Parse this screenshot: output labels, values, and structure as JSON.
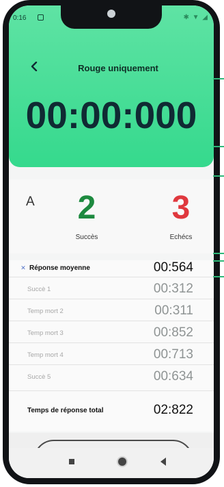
{
  "status_bar": {
    "time": "0:16"
  },
  "header": {
    "title": "Rouge uniquement",
    "timer": "00:00:000"
  },
  "stats": {
    "label": "A",
    "success_count": "2",
    "success_label": "Succès",
    "fail_count": "3",
    "fail_label": "Echécs"
  },
  "list": {
    "average": {
      "label": "Réponse moyenne",
      "value": "00:564",
      "icon": "x-icon"
    },
    "rows": [
      {
        "label": "Succè 1",
        "value": "00:312"
      },
      {
        "label": "Temp mort 2",
        "value": "00:311"
      },
      {
        "label": "Temp mort 3",
        "value": "00:852"
      },
      {
        "label": "Temp mort 4",
        "value": "00:713"
      },
      {
        "label": "Succè 5",
        "value": "00:634"
      }
    ],
    "total": {
      "label": "Temps de réponse total",
      "value": "02:822"
    }
  },
  "colors": {
    "header_green": "#35d98d",
    "success_green": "#1d8a3f",
    "fail_red": "#e0383e",
    "annotation_green": "#2fb87a"
  }
}
